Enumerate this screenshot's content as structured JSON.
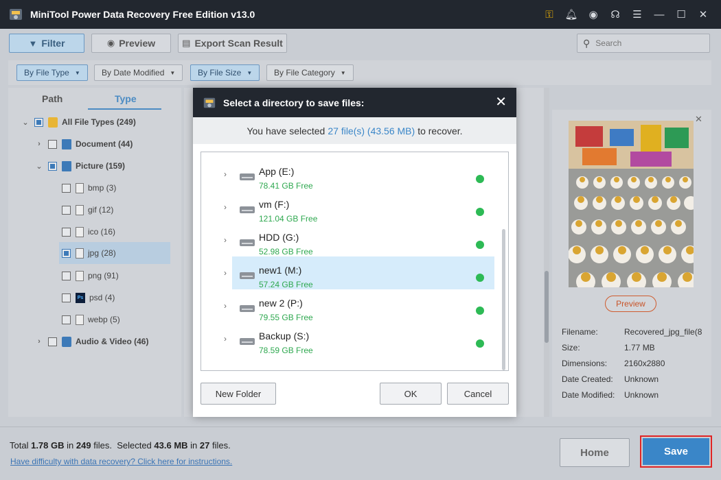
{
  "app": {
    "title": "MiniTool Power Data Recovery Free Edition v13.0"
  },
  "titlebar_icons": [
    "key-icon",
    "bell-icon",
    "disc-icon",
    "headset-icon",
    "menu-icon",
    "minimize-icon",
    "maximize-icon",
    "close-icon"
  ],
  "toolbar": {
    "filter": "Filter",
    "preview": "Preview",
    "export": "Export Scan Result",
    "search_placeholder": "Search"
  },
  "filters": {
    "by_file_type": "By File Type",
    "by_date_modified": "By Date Modified",
    "by_file_size": "By File Size",
    "by_file_category": "By File Category"
  },
  "left_tabs": {
    "path": "Path",
    "type": "Type"
  },
  "tree": {
    "all": "All File Types (249)",
    "document": "Document (44)",
    "picture": "Picture (159)",
    "bmp": "bmp (3)",
    "gif": "gif (12)",
    "ico": "ico (16)",
    "jpg": "jpg (28)",
    "png": "png (91)",
    "psd": "psd (4)",
    "webp": "webp (5)",
    "audio_video": "Audio & Video (46)"
  },
  "preview_panel": {
    "preview_button": "Preview",
    "filename_label": "Filename:",
    "filename_value": "Recovered_jpg_file(8",
    "size_label": "Size:",
    "size_value": "1.77 MB",
    "dimensions_label": "Dimensions:",
    "dimensions_value": "2160x2880",
    "date_created_label": "Date Created:",
    "date_created_value": "Unknown",
    "date_modified_label": "Date Modified:",
    "date_modified_value": "Unknown"
  },
  "bottom": {
    "total_prefix": "Total",
    "total_size": "1.78 GB",
    "in": "in",
    "total_files": "249",
    "files": "files.",
    "selected_prefix": "Selected",
    "selected_size": "43.6 MB",
    "selected_files": "27",
    "help": "Have difficulty with data recovery? Click here for instructions.",
    "home": "Home",
    "save": "Save"
  },
  "dialog": {
    "title": "Select a directory to save files:",
    "sub_prefix": "You have selected",
    "sub_highlight": "27 file(s) (43.56 MB)",
    "sub_suffix": "to recover.",
    "drives": [
      {
        "name": "App (E:)",
        "free": "78.41 GB Free"
      },
      {
        "name": "vm (F:)",
        "free": "121.04 GB Free"
      },
      {
        "name": "HDD (G:)",
        "free": "52.98 GB Free"
      },
      {
        "name": "new1 (M:)",
        "free": "57.24 GB Free"
      },
      {
        "name": "new 2 (P:)",
        "free": "79.55 GB Free"
      },
      {
        "name": "Backup (S:)",
        "free": "78.59 GB Free"
      }
    ],
    "new_folder": "New Folder",
    "ok": "OK",
    "cancel": "Cancel"
  },
  "colors": {
    "accent": "#3a86c8",
    "titlebar": "#22272f",
    "free_green": "#2ea84f",
    "save_outline": "#e02424"
  }
}
